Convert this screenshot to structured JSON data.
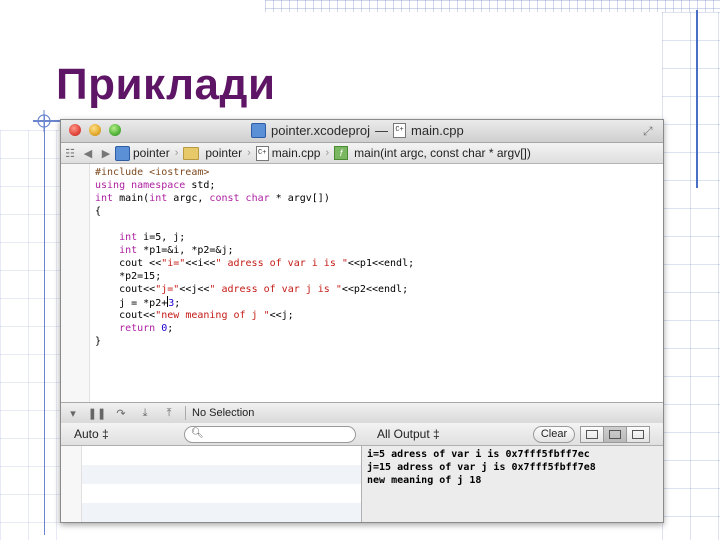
{
  "slide": {
    "title": "Приклади"
  },
  "window": {
    "project_name": "pointer.xcodeproj",
    "title_separator": "—",
    "file_name": "main.cpp"
  },
  "jumpbar": {
    "items": [
      "pointer",
      "pointer",
      "main.cpp",
      "main(int argc, const char * argv[])"
    ]
  },
  "code": {
    "lines": [
      [
        {
          "t": "#include <iostream>",
          "c": "pp"
        }
      ],
      [
        {
          "t": "using namespace ",
          "c": "kw"
        },
        {
          "t": "std;",
          "c": ""
        }
      ],
      [
        {
          "t": "int ",
          "c": "kw"
        },
        {
          "t": "main(",
          "c": ""
        },
        {
          "t": "int ",
          "c": "kw"
        },
        {
          "t": "argc, ",
          "c": ""
        },
        {
          "t": "const char ",
          "c": "kw"
        },
        {
          "t": "* argv[])",
          "c": ""
        }
      ],
      [
        {
          "t": "{",
          "c": ""
        }
      ],
      [],
      [
        {
          "t": "    int ",
          "c": "kw"
        },
        {
          "t": "i=5, j;",
          "c": ""
        }
      ],
      [
        {
          "t": "    int ",
          "c": "kw"
        },
        {
          "t": "*p1=&i, *p2=&j;",
          "c": ""
        }
      ],
      [
        {
          "t": "    cout <<",
          "c": ""
        },
        {
          "t": "\"i=\"",
          "c": "str"
        },
        {
          "t": "<<i<<",
          "c": ""
        },
        {
          "t": "\" adress of var i is \"",
          "c": "str"
        },
        {
          "t": "<<p1<<endl;",
          "c": ""
        }
      ],
      [
        {
          "t": "    *p2=15;",
          "c": ""
        }
      ],
      [
        {
          "t": "    cout<<",
          "c": ""
        },
        {
          "t": "\"j=\"",
          "c": "str"
        },
        {
          "t": "<<j<<",
          "c": ""
        },
        {
          "t": "\" adress of var j is \"",
          "c": "str"
        },
        {
          "t": "<<p2<<endl;",
          "c": ""
        }
      ],
      [
        {
          "t": "    j = *p2+",
          "c": ""
        },
        {
          "t": "CURSOR",
          "c": "cursor"
        },
        {
          "t": "3",
          "c": "num"
        },
        {
          "t": ";",
          "c": ""
        }
      ],
      [
        {
          "t": "    cout<<",
          "c": ""
        },
        {
          "t": "\"new meaning of j \"",
          "c": "str"
        },
        {
          "t": "<<j;",
          "c": ""
        }
      ],
      [
        {
          "t": "    return ",
          "c": "kw"
        },
        {
          "t": "0",
          "c": "num"
        },
        {
          "t": ";",
          "c": ""
        }
      ],
      [
        {
          "t": "}",
          "c": ""
        }
      ]
    ]
  },
  "debugbar": {
    "status": "No Selection"
  },
  "filterbar": {
    "scope": "Auto ‡",
    "output": "All Output ‡",
    "clear_label": "Clear"
  },
  "console": {
    "lines": [
      "i=5 adress of var i is 0x7fff5fbff7ec",
      "j=15 adress of var j is 0x7fff5fbff7e8",
      "new meaning of j 18"
    ]
  },
  "colors": {
    "title": "#5e1565",
    "keyword": "#ad1fa0",
    "string": "#c41a16",
    "number": "#1c00cf",
    "preprocessor": "#7d4a21"
  }
}
